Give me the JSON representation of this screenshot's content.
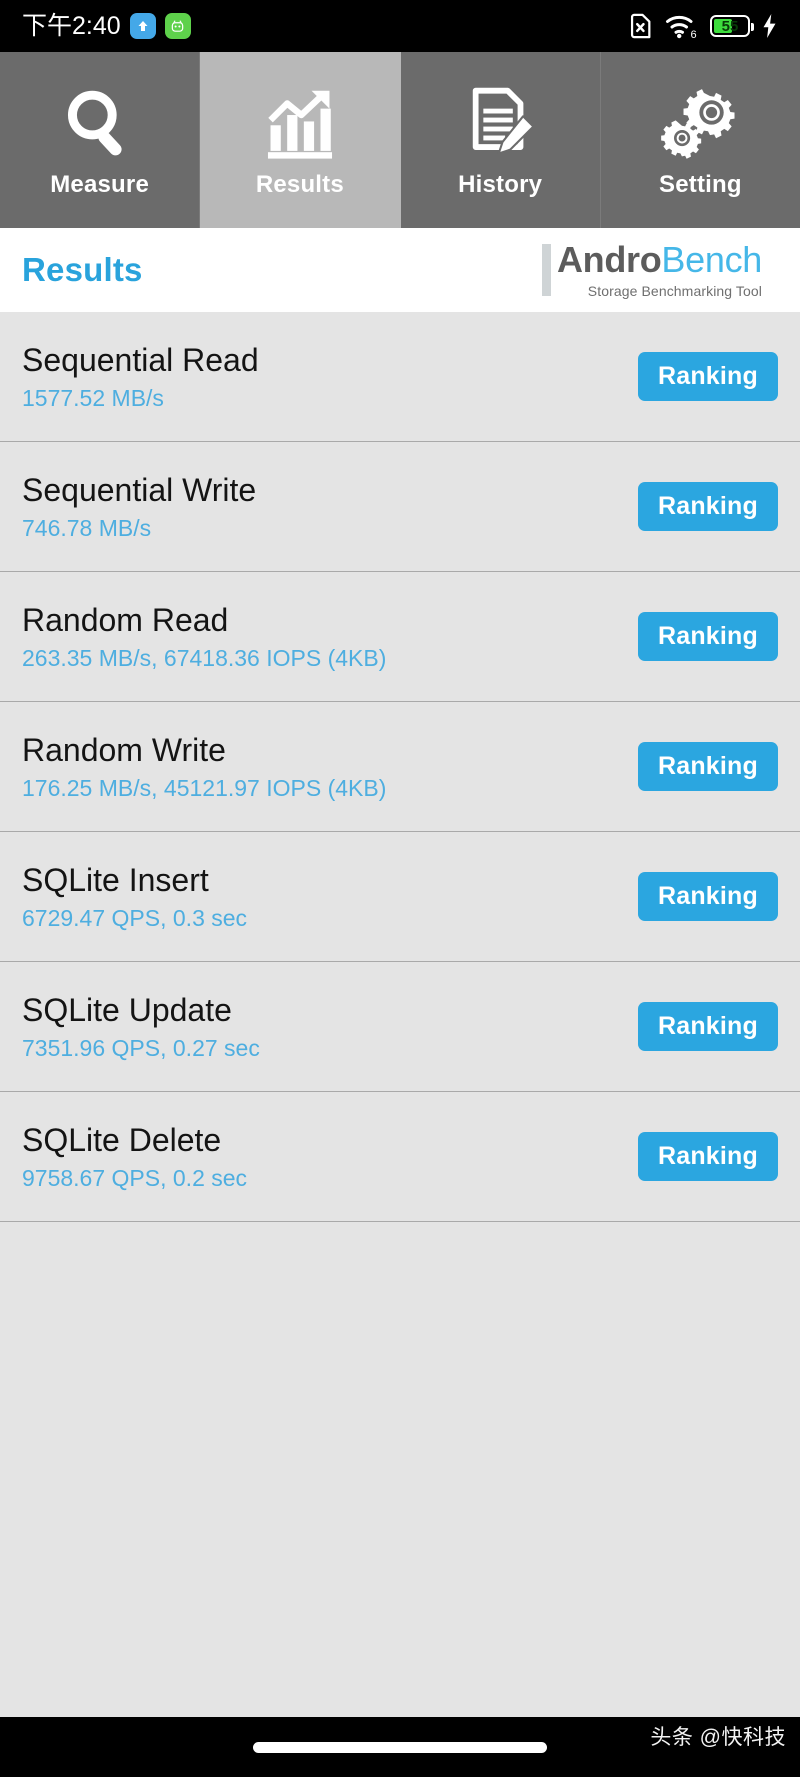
{
  "statusbar": {
    "clock": "下午2:40",
    "badges": [
      {
        "name": "upload-arrow-badge",
        "glyph": "↑",
        "color": "#44a8e8"
      },
      {
        "name": "app-notification-badge",
        "glyph": "◎",
        "color": "#5ed14b"
      }
    ],
    "sim_icon": "sim-card-off-icon",
    "wifi_icon": "wifi-6-icon",
    "wifi_generation": "6",
    "battery_percent": "55",
    "battery_color": "#3ddc3d",
    "charging_icon": "charging-bolt-icon"
  },
  "tabs": [
    {
      "label": "Measure",
      "icon": "magnifier-icon",
      "active": false
    },
    {
      "label": "Results",
      "icon": "bar-chart-trend-icon",
      "active": true
    },
    {
      "label": "History",
      "icon": "document-pencil-icon",
      "active": false
    },
    {
      "label": "Setting",
      "icon": "gears-icon",
      "active": false
    }
  ],
  "header": {
    "title": "Results",
    "title_color": "#29a3dc",
    "brand_first": "Andro",
    "brand_second": "Bench",
    "brand_subtitle": "Storage Benchmarking Tool",
    "brand_accent": "#45b7e8"
  },
  "results": {
    "button_label": "Ranking",
    "button_color": "#2ba6e0",
    "value_color": "#4eaee0",
    "rows": [
      {
        "title": "Sequential Read",
        "value": "1577.52 MB/s"
      },
      {
        "title": "Sequential Write",
        "value": "746.78 MB/s"
      },
      {
        "title": "Random Read",
        "value": "263.35 MB/s, 67418.36 IOPS (4KB)"
      },
      {
        "title": "Random Write",
        "value": "176.25 MB/s, 45121.97 IOPS (4KB)"
      },
      {
        "title": "SQLite Insert",
        "value": "6729.47 QPS, 0.3 sec"
      },
      {
        "title": "SQLite Update",
        "value": "7351.96 QPS, 0.27 sec"
      },
      {
        "title": "SQLite Delete",
        "value": "9758.67 QPS, 0.2 sec"
      }
    ]
  },
  "footer": {
    "watermark": "头条 @快科技",
    "home_indicator": "home-indicator"
  }
}
